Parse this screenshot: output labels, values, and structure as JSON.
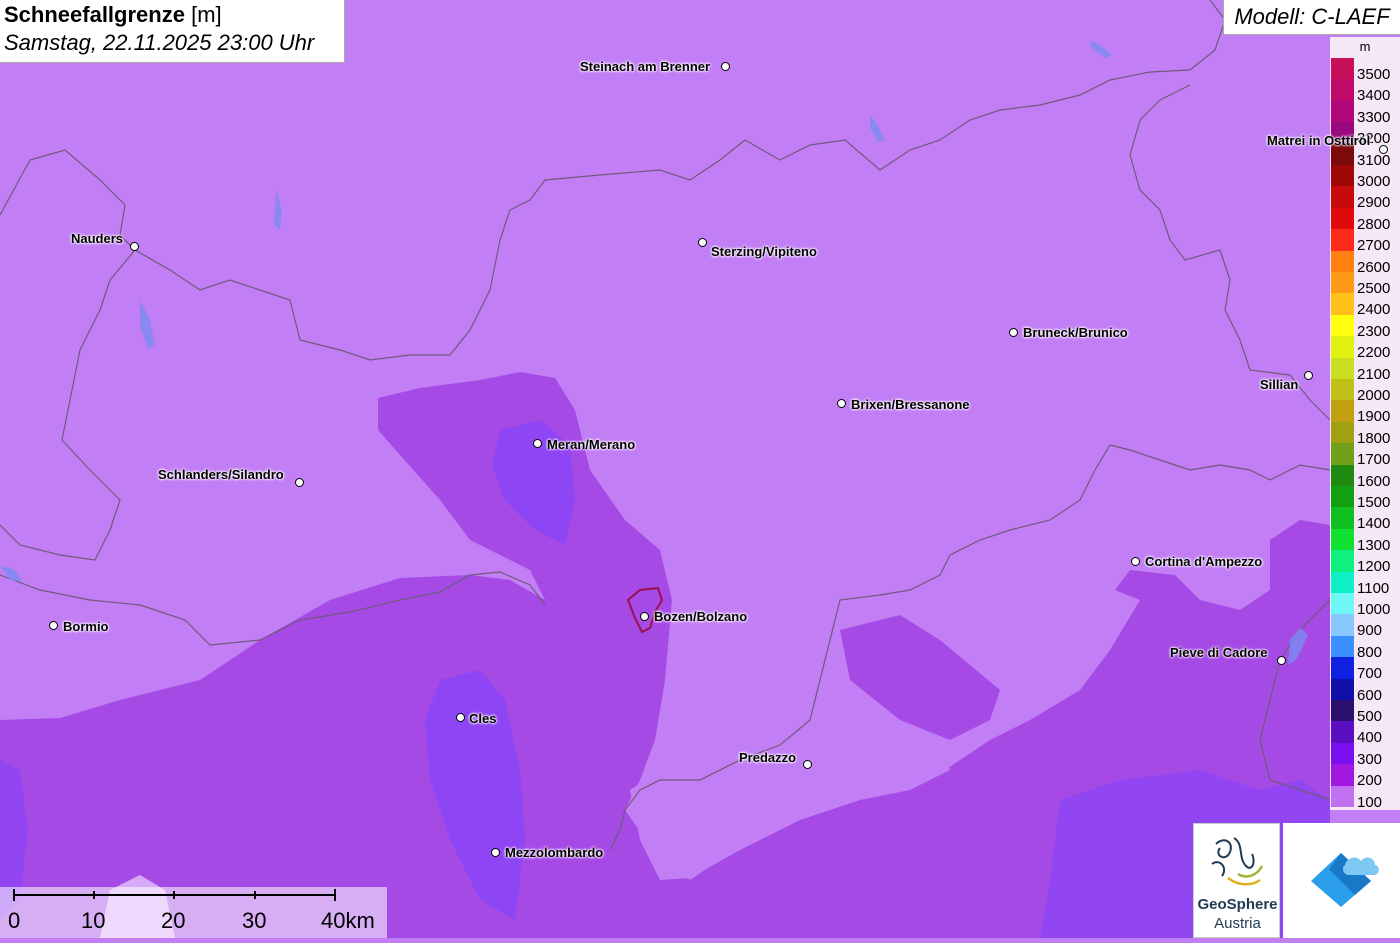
{
  "title": {
    "parameter": "Schneefallgrenze",
    "unit": "[m]",
    "datetime": "Samstag, 22.11.2025 23:00 Uhr"
  },
  "model": "Modell: C-LAEF",
  "legend": {
    "unit": "m",
    "entries": [
      {
        "value": "3500",
        "color": "#c8105a"
      },
      {
        "value": "3400",
        "color": "#c00a6a"
      },
      {
        "value": "3300",
        "color": "#b0087a"
      },
      {
        "value": "3200",
        "color": "#9a0880"
      },
      {
        "value": "3100",
        "color": "#7d0a0a"
      },
      {
        "value": "3000",
        "color": "#a00808"
      },
      {
        "value": "2900",
        "color": "#c80a0a"
      },
      {
        "value": "2800",
        "color": "#e00a0a"
      },
      {
        "value": "2700",
        "color": "#ff2a1a"
      },
      {
        "value": "2600",
        "color": "#ff8010"
      },
      {
        "value": "2500",
        "color": "#ff9a18"
      },
      {
        "value": "2400",
        "color": "#ffc01a"
      },
      {
        "value": "2300",
        "color": "#ffff10"
      },
      {
        "value": "2200",
        "color": "#e0f010"
      },
      {
        "value": "2100",
        "color": "#c8e020"
      },
      {
        "value": "2000",
        "color": "#c0c018"
      },
      {
        "value": "1900",
        "color": "#c0a010"
      },
      {
        "value": "1800",
        "color": "#a0a010"
      },
      {
        "value": "1700",
        "color": "#70a018"
      },
      {
        "value": "1600",
        "color": "#208a10"
      },
      {
        "value": "1500",
        "color": "#10a010"
      },
      {
        "value": "1400",
        "color": "#10c020"
      },
      {
        "value": "1300",
        "color": "#10e030"
      },
      {
        "value": "1200",
        "color": "#10f080"
      },
      {
        "value": "1100",
        "color": "#10f0c8"
      },
      {
        "value": "1000",
        "color": "#70f8f8"
      },
      {
        "value": "900",
        "color": "#88c8ff"
      },
      {
        "value": "800",
        "color": "#3a90ff"
      },
      {
        "value": "700",
        "color": "#1020e0"
      },
      {
        "value": "600",
        "color": "#1010a8"
      },
      {
        "value": "500",
        "color": "#2c1070"
      },
      {
        "value": "400",
        "color": "#5a10c0"
      },
      {
        "value": "300",
        "color": "#7a10f0"
      },
      {
        "value": "200",
        "color": "#a018e0"
      },
      {
        "value": "100",
        "color": "#c070f0"
      }
    ]
  },
  "places": [
    {
      "name": "Steinach am Brenner"
    },
    {
      "name": "Matrei in Osttirol"
    },
    {
      "name": "Nauders"
    },
    {
      "name": "Sterzing/Vipiteno"
    },
    {
      "name": "Bruneck/Brunico"
    },
    {
      "name": "Sillian"
    },
    {
      "name": "Brixen/Bressanone"
    },
    {
      "name": "Meran/Merano"
    },
    {
      "name": "Schlanders/Silandro"
    },
    {
      "name": "Cortina d'Ampezzo"
    },
    {
      "name": "Bormio"
    },
    {
      "name": "Bozen/Bolzano"
    },
    {
      "name": "Pieve di Cadore"
    },
    {
      "name": "Cles"
    },
    {
      "name": "Predazzo"
    },
    {
      "name": "Mezzolombardo"
    }
  ],
  "scale": {
    "labels": [
      "0",
      "10",
      "20",
      "30",
      "40km"
    ]
  },
  "logos": {
    "geosphere_line1": "GeoSphere",
    "geosphere_line2": "Austria"
  },
  "colors": {
    "band_100": "#c27ff5",
    "band_200": "#a64fe6",
    "band_300": "#8a45f5",
    "border": "#6f5a7a"
  }
}
